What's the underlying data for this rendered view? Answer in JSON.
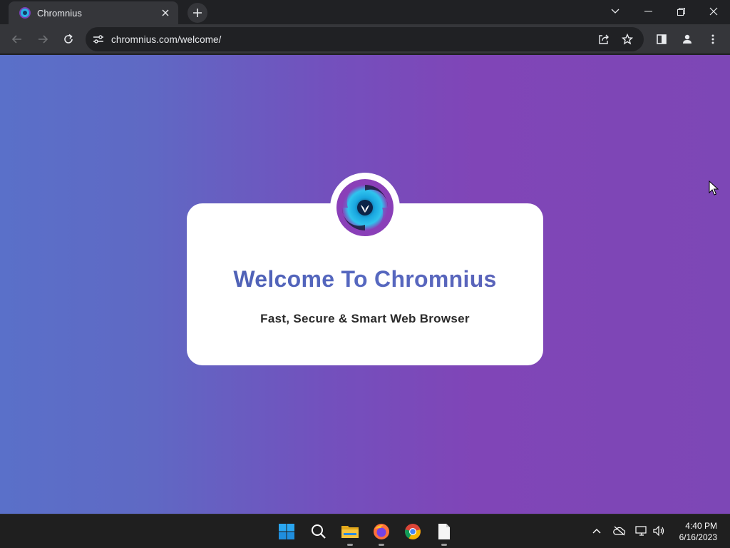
{
  "browser": {
    "tab": {
      "title": "Chromnius",
      "favicon": "chromnius-logo-icon"
    },
    "new_tab_icon": "plus-icon",
    "window_controls": [
      "chevron-down-icon",
      "minimize-icon",
      "restore-icon",
      "close-icon"
    ],
    "toolbar": {
      "back_icon": "arrow-left-icon",
      "forward_icon": "arrow-right-icon",
      "reload_icon": "reload-icon",
      "site_info_icon": "tune-icon",
      "url": "chromnius.com/welcome/",
      "share_icon": "share-icon",
      "bookmark_icon": "star-icon",
      "side_panel_icon": "side-panel-icon",
      "profile_icon": "profile-icon",
      "menu_icon": "more-vert-icon"
    }
  },
  "page": {
    "headline": "Welcome To Chromnius",
    "tagline": "Fast, Secure & Smart Web Browser",
    "colors": {
      "gradient_start": "#5a70c9",
      "gradient_end": "#7d47b6",
      "headline": "#5565bc",
      "card": "#ffffff"
    }
  },
  "taskbar": {
    "apps": [
      "windows-start-icon",
      "search-icon",
      "file-explorer-icon",
      "firefox-icon",
      "chrome-icon",
      "file-icon"
    ],
    "tray": [
      "chevron-up-icon",
      "cloud-off-icon",
      "network-icon",
      "volume-icon"
    ],
    "time": "4:40 PM",
    "date": "6/16/2023"
  }
}
